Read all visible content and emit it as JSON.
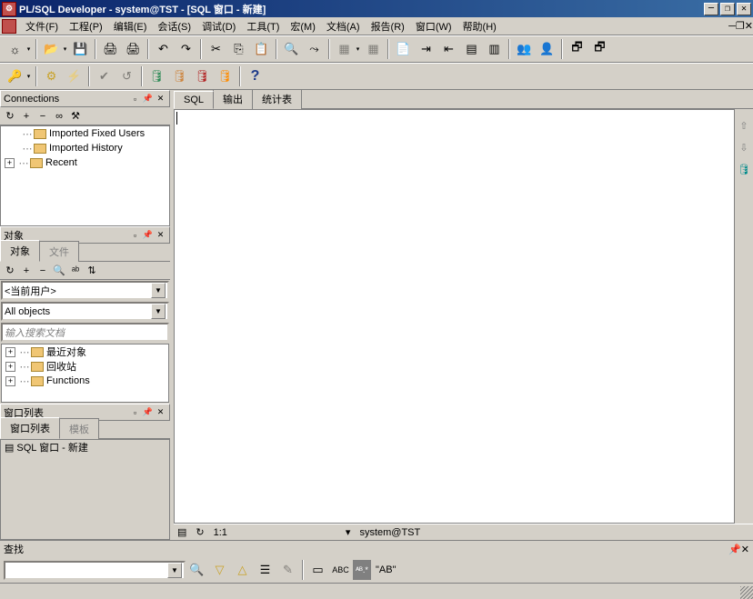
{
  "title": "PL/SQL Developer - system@TST - [SQL 窗口 - 新建]",
  "menu": {
    "file": "文件(F)",
    "project": "工程(P)",
    "edit": "编辑(E)",
    "session": "会话(S)",
    "debug": "调试(D)",
    "tools": "工具(T)",
    "macro": "宏(M)",
    "doc": "文档(A)",
    "report": "报告(R)",
    "window": "窗口(W)",
    "help": "帮助(H)"
  },
  "panels": {
    "connections": {
      "title": "Connections",
      "items": [
        "Imported Fixed Users",
        "Imported History",
        "Recent"
      ]
    },
    "objects": {
      "title": "对象",
      "tabs": {
        "obj": "对象",
        "file": "文件"
      },
      "user_combo": "<当前用户>",
      "filter_combo": "All objects",
      "search_placeholder": "输入搜索文档",
      "tree": [
        "最近对象",
        "回收站",
        "Functions"
      ]
    },
    "windowlist": {
      "title": "窗口列表",
      "tabs": {
        "winlist": "窗口列表",
        "template": "模板"
      },
      "item": "SQL 窗口 - 新建"
    }
  },
  "editor": {
    "tabs": {
      "sql": "SQL",
      "output": "输出",
      "stats": "统计表"
    }
  },
  "status": {
    "pos": "1:1",
    "conn": "system@TST"
  },
  "find": {
    "title": "查找",
    "tail": "\"AB\"",
    "abc": "ABC"
  }
}
